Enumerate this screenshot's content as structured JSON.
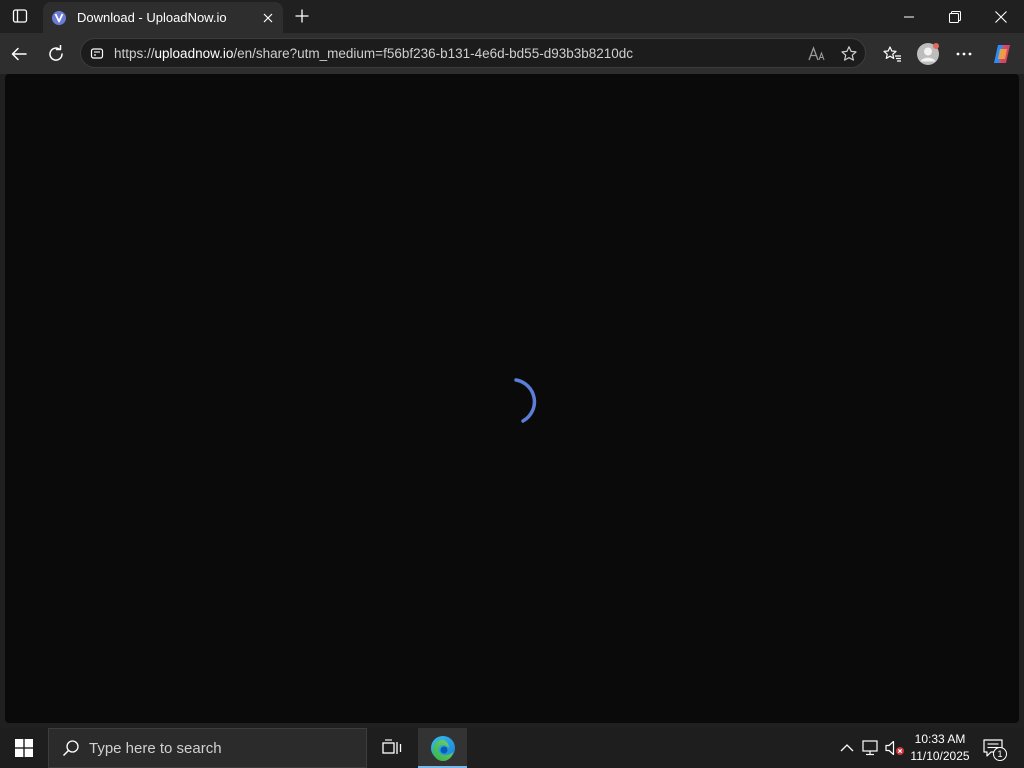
{
  "browser": {
    "tab": {
      "title": "Download - UploadNow.io",
      "favicon": "uploadnow-favicon-icon"
    },
    "address_bar": {
      "url_scheme": "https://",
      "url_host": "uploadnow.io",
      "url_path": "/en/share?utm_medium=f56bf236-b131-4e6d-bd55-d93b3b8210dc"
    }
  },
  "page": {
    "state": "loading",
    "spinner_color": "#5b7fd9",
    "background": "#0a0a0a"
  },
  "taskbar": {
    "search_placeholder": "Type here to search",
    "clock": {
      "time": "10:33 AM",
      "date": "11/10/2025"
    },
    "notification_count": "1"
  },
  "colors": {
    "titlebar": "#202020",
    "toolbar": "#2e2e2e",
    "taskbar": "#1e1e1e",
    "accent": "#76b9ed"
  }
}
